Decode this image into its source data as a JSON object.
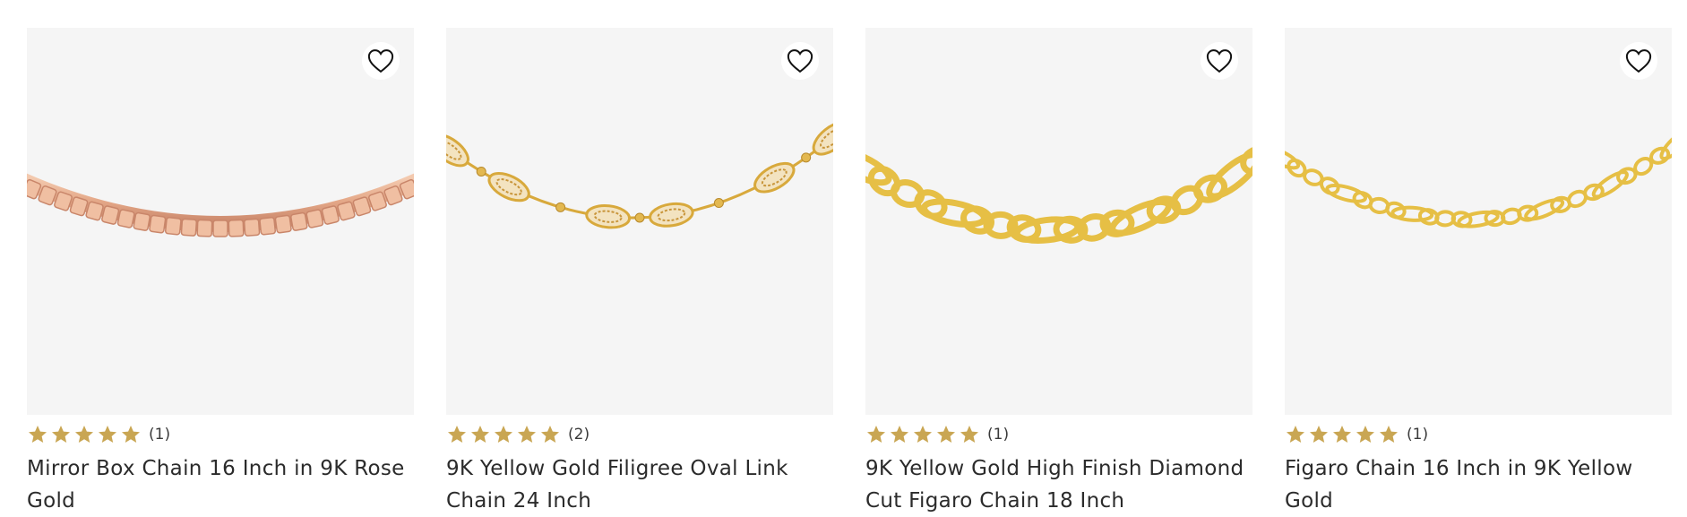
{
  "colors": {
    "star": "#c9a653",
    "image_bg": "#f5f5f5",
    "rose_gold": "#e4a888",
    "yellow_gold": "#e8c04a"
  },
  "icons": {
    "wishlist": "heart-outline-icon",
    "rating": "star-icon"
  },
  "products": [
    {
      "title": "Mirror Box Chain 16 Inch in 9K Rose Gold",
      "rating": 5,
      "review_count": "(1)",
      "image_alt": "rose-gold-box-chain"
    },
    {
      "title": "9K Yellow Gold Filigree Oval Link Chain 24 Inch",
      "rating": 5,
      "review_count": "(2)",
      "image_alt": "yellow-gold-filigree-chain"
    },
    {
      "title": "9K Yellow Gold High Finish Diamond Cut Figaro Chain 18 Inch",
      "rating": 5,
      "review_count": "(1)",
      "image_alt": "yellow-gold-figaro-chain-heavy"
    },
    {
      "title": "Figaro Chain 16 Inch in 9K Yellow Gold",
      "rating": 5,
      "review_count": "(1)",
      "image_alt": "yellow-gold-figaro-chain-fine"
    }
  ]
}
